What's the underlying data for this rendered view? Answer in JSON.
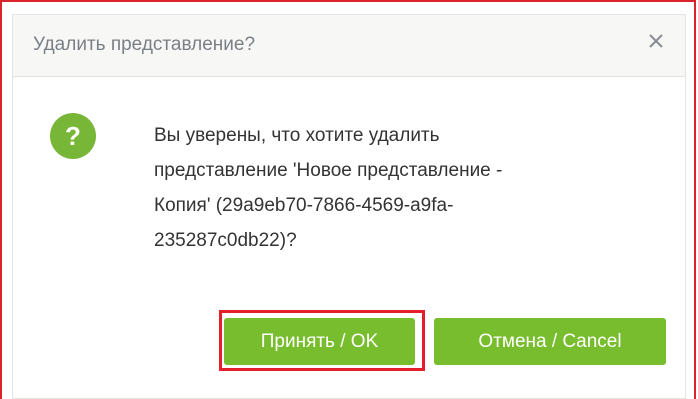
{
  "dialog": {
    "title": "Удалить представление?",
    "close_icon": "close-icon",
    "question_icon": "question-icon",
    "question_glyph": "?",
    "message_lines": [
      "Вы уверены, что хотите удалить",
      "представление 'Новое представление -",
      "Копия' (29a9eb70-7866-4569-a9fa-",
      "235287c0db22)?"
    ],
    "ok_label": "Принять / OK",
    "cancel_label": "Отмена / Cancel"
  },
  "colors": {
    "accent_green": "#78bd2e",
    "highlight_red": "#e51e2b"
  }
}
